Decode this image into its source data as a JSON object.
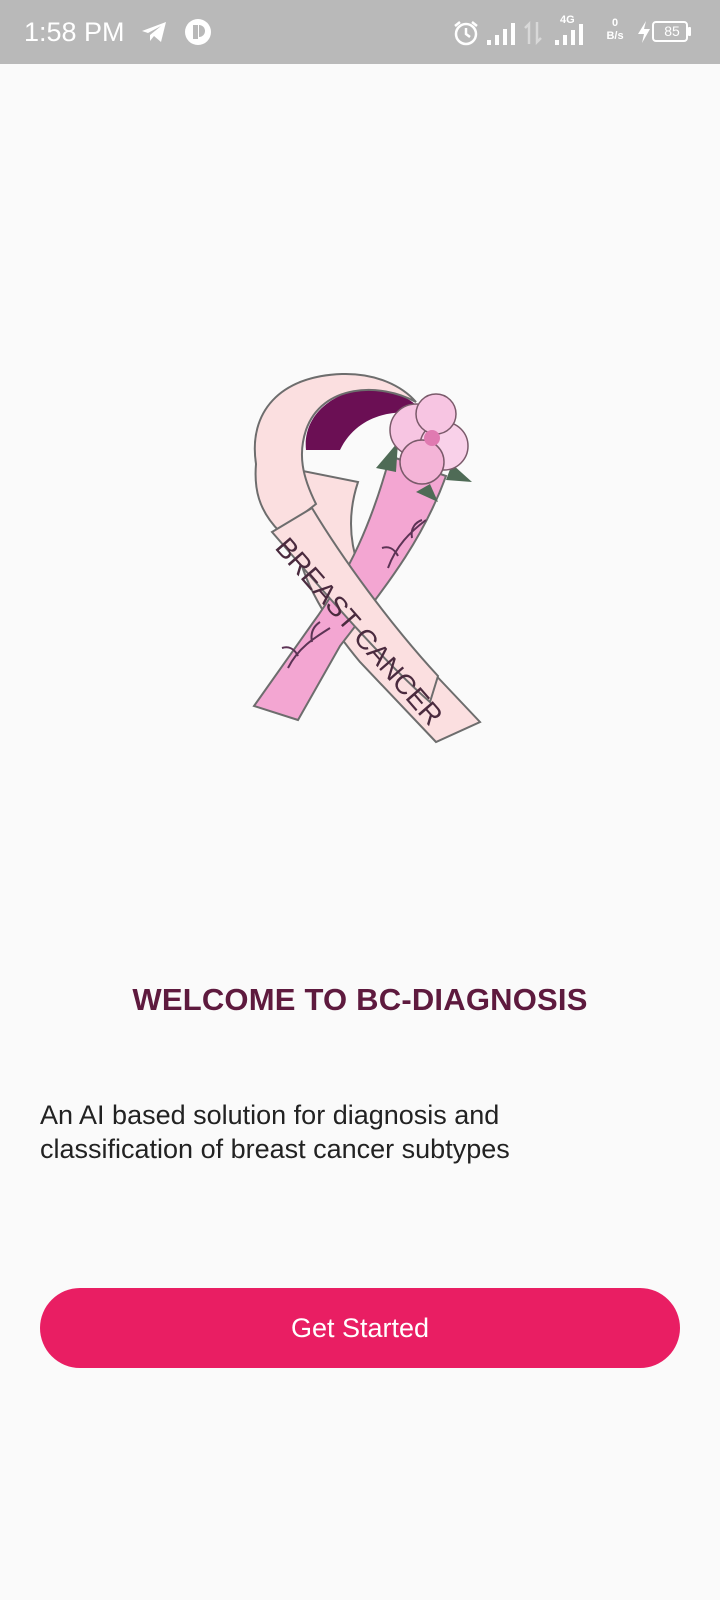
{
  "status_bar": {
    "time": "1:58 PM",
    "network_type": "4G",
    "speed_value": "0",
    "speed_unit": "B/s",
    "battery_level": "85",
    "icons": [
      "telegram-icon",
      "app-notification-icon",
      "alarm-icon",
      "signal-icon",
      "data-transfer-icon",
      "signal-4g-icon",
      "charging-icon",
      "battery-icon"
    ]
  },
  "logo": {
    "ribbon_text": "BREAST CANCER",
    "icon": "pink-ribbon-icon"
  },
  "welcome": {
    "title": "WELCOME TO BC-DIAGNOSIS",
    "description": "An AI based solution for diagnosis and classification of breast cancer subtypes"
  },
  "actions": {
    "get_started_label": "Get Started"
  },
  "colors": {
    "status_bar": "#b9b9b9",
    "background": "#fafafa",
    "title": "#5e1a3e",
    "button": "#e91e63",
    "ribbon_pink": "#f3a6d2",
    "ribbon_light": "#fbdfe0",
    "ribbon_dark": "#6b0f54"
  }
}
